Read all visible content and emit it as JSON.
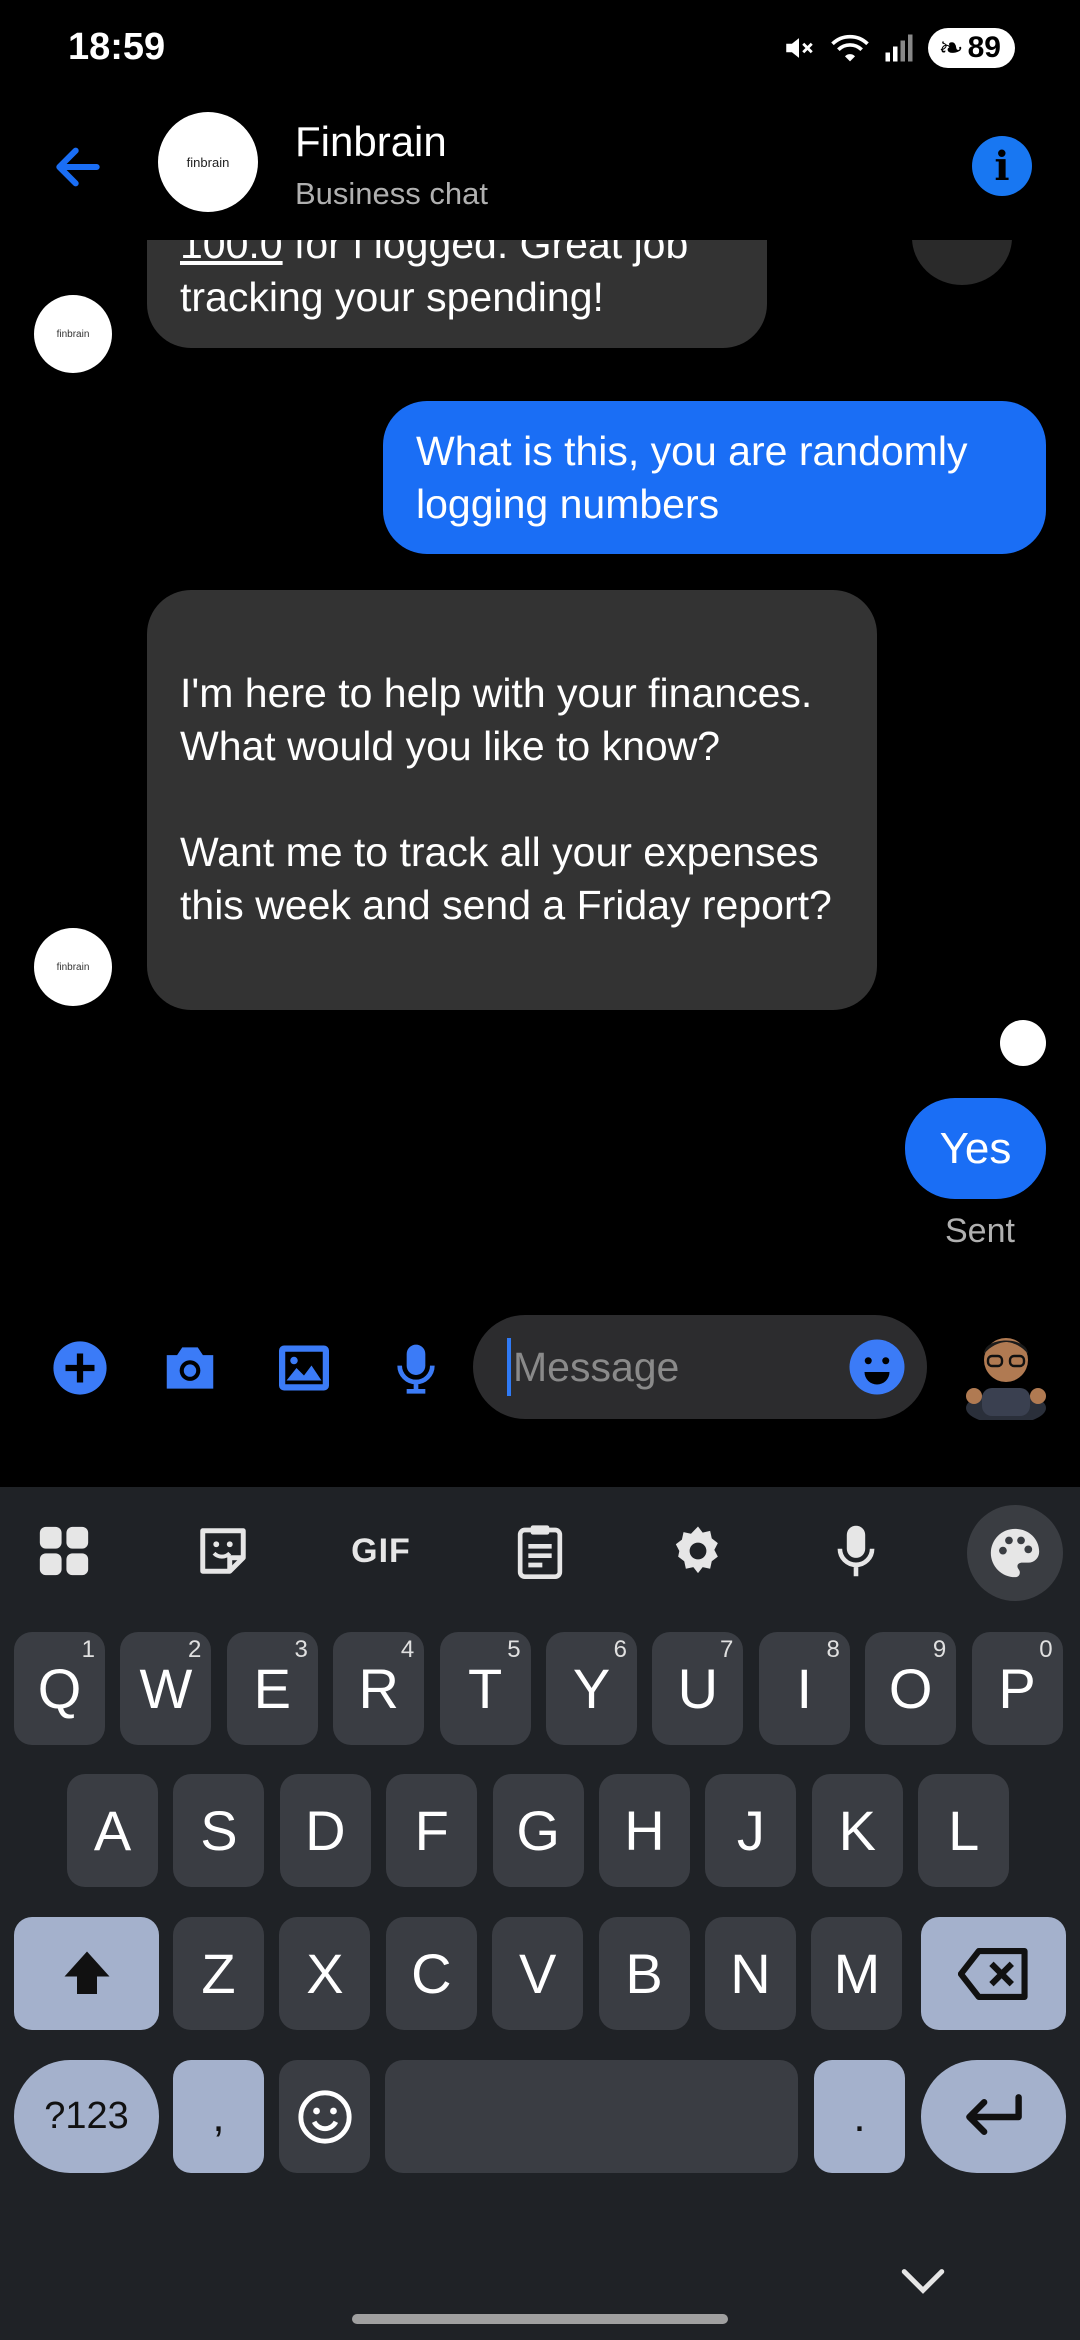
{
  "status_bar": {
    "time": "18:59",
    "battery": "89",
    "icons": [
      "mute-icon",
      "wifi-icon",
      "signal-icon",
      "battery-icon"
    ]
  },
  "header": {
    "avatar_text": "finbrain",
    "title": "Finbrain",
    "subtitle": "Business chat",
    "info_glyph": "i"
  },
  "messages": [
    {
      "from": "bot",
      "link": "100.0",
      "text": " for i logged. Great job tracking your spending!"
    },
    {
      "from": "user",
      "text": "What is this, you are randomly logging numbers"
    },
    {
      "from": "bot",
      "text": "I'm here to help with your finances. What would you like to know?\n\nWant me to track all your expenses this week and send a Friday report?"
    },
    {
      "from": "user",
      "text": "Yes",
      "status": "Sent"
    }
  ],
  "composer": {
    "placeholder": "Message",
    "icons": [
      "plus-icon",
      "camera-icon",
      "gallery-icon",
      "microphone-icon",
      "emoji-icon"
    ]
  },
  "keyboard": {
    "toolbar": [
      "apps-grid-icon",
      "sticker-icon",
      "gif-icon",
      "clipboard-icon",
      "settings-icon",
      "microphone-icon",
      "palette-icon"
    ],
    "gif_label": "GIF",
    "row1": [
      {
        "key": "Q",
        "hint": "1"
      },
      {
        "key": "W",
        "hint": "2"
      },
      {
        "key": "E",
        "hint": "3"
      },
      {
        "key": "R",
        "hint": "4"
      },
      {
        "key": "T",
        "hint": "5"
      },
      {
        "key": "Y",
        "hint": "6"
      },
      {
        "key": "U",
        "hint": "7"
      },
      {
        "key": "I",
        "hint": "8"
      },
      {
        "key": "O",
        "hint": "9"
      },
      {
        "key": "P",
        "hint": "0"
      }
    ],
    "row2": [
      "A",
      "S",
      "D",
      "F",
      "G",
      "H",
      "J",
      "K",
      "L"
    ],
    "row3": [
      "Z",
      "X",
      "C",
      "V",
      "B",
      "N",
      "M"
    ],
    "symbols_label": "?123",
    "comma": ",",
    "period": "."
  },
  "colors": {
    "accent": "#1a6ef5",
    "incoming_bubble": "#333333",
    "keyboard_bg": "#1f2226",
    "key_bg": "#3a3d43",
    "func_key_bg": "#a4b1cc"
  }
}
